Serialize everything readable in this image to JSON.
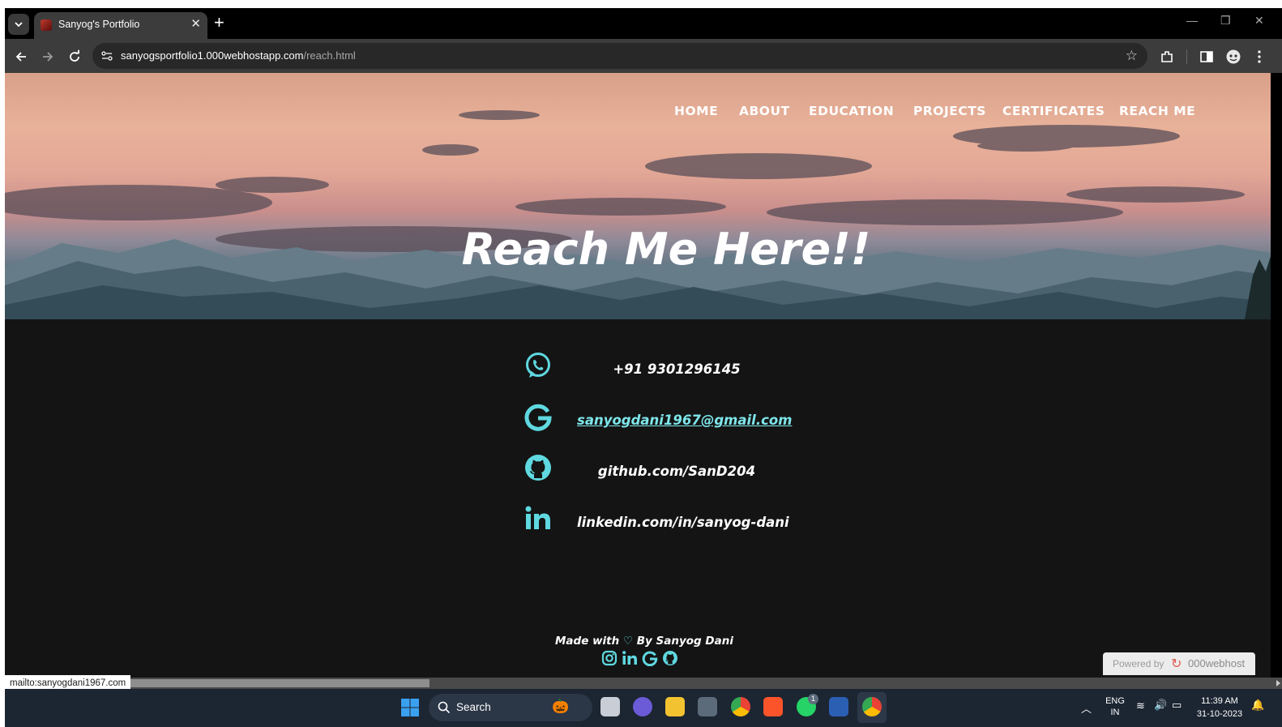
{
  "browser": {
    "tab_title": "Sanyog's Portfolio",
    "url_host": "sanyogsportfolio1.000webhostapp.com",
    "url_path": "/reach.html"
  },
  "nav": {
    "items": [
      "HOME",
      "ABOUT",
      "EDUCATION",
      "PROJECTS",
      "CERTIFICATES",
      "REACH ME"
    ]
  },
  "hero": {
    "title": "Reach Me Here!!"
  },
  "contacts": [
    {
      "icon": "whatsapp-icon",
      "text": "+91 9301296145"
    },
    {
      "icon": "google-icon",
      "text": "sanyogdani1967@gmail.com"
    },
    {
      "icon": "github-icon",
      "text": "github.com/SanD204"
    },
    {
      "icon": "linkedin-icon",
      "text": "linkedin.com/in/sanyog-dani"
    }
  ],
  "footer": {
    "made_with": "Made with",
    "by": "By Sanyog Dani",
    "icons": [
      "instagram-icon",
      "linkedin-icon",
      "google-icon",
      "github-icon"
    ]
  },
  "powered_by": {
    "label": "Powered by",
    "brand": "000webhost"
  },
  "status_bar": "mailto:sanyogdani1967.com",
  "taskbar": {
    "search_label": "Search",
    "lang_primary": "ENG",
    "lang_secondary": "IN",
    "time": "11:39 AM",
    "date": "31-10-2023",
    "whatsapp_badge": "1"
  },
  "colors": {
    "accent": "#5fd8e0",
    "page_bg": "#141414",
    "link": "#7ee6ea"
  }
}
